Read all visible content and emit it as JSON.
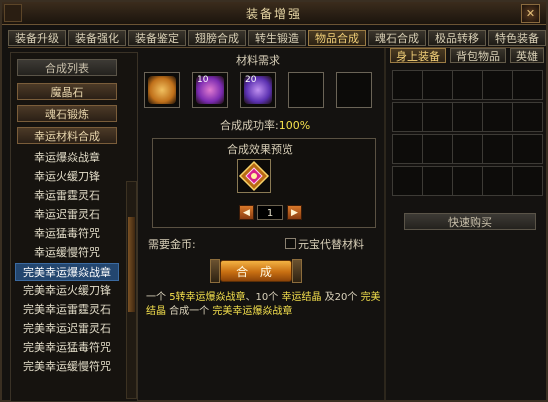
{
  "window": {
    "title": "装备增强",
    "close_icon": "close-icon"
  },
  "tabs": [
    {
      "label": "装备升级",
      "active": false
    },
    {
      "label": "装备强化",
      "active": false
    },
    {
      "label": "装备鉴定",
      "active": false
    },
    {
      "label": "翅膀合成",
      "active": false
    },
    {
      "label": "转生锻造",
      "active": false
    },
    {
      "label": "物品合成",
      "active": true
    },
    {
      "label": "魂石合成",
      "active": false
    },
    {
      "label": "极品转移",
      "active": false
    },
    {
      "label": "特色装备",
      "active": false
    }
  ],
  "sidebar": {
    "header": "合成列表",
    "categories": [
      "魔晶石",
      "魂石锻炼",
      "幸运材料合成"
    ],
    "items": [
      {
        "label": "幸运爆焱战章",
        "selected": false
      },
      {
        "label": "幸运火缓刀锋",
        "selected": false
      },
      {
        "label": "幸运雷霆灵石",
        "selected": false
      },
      {
        "label": "幸运迟雷灵石",
        "selected": false
      },
      {
        "label": "幸运猛毒符咒",
        "selected": false
      },
      {
        "label": "幸运缓慢符咒",
        "selected": false
      },
      {
        "label": "完美幸运爆焱战章",
        "selected": true
      },
      {
        "label": "完美幸运火缓刀锋",
        "selected": false
      },
      {
        "label": "完美幸运雷霆灵石",
        "selected": false
      },
      {
        "label": "完美幸运迟雷灵石",
        "selected": false
      },
      {
        "label": "完美幸运猛毒符咒",
        "selected": false
      },
      {
        "label": "完美幸运缓慢符咒",
        "selected": false
      }
    ]
  },
  "materials": {
    "title": "材料需求",
    "slots": [
      {
        "icon": "war-badge-icon",
        "count": ""
      },
      {
        "icon": "purple-crystal-icon",
        "count": "10"
      },
      {
        "icon": "violet-gem-icon",
        "count": "20"
      },
      {
        "icon": "empty-slot-icon",
        "count": ""
      },
      {
        "icon": "empty-slot-icon",
        "count": ""
      }
    ]
  },
  "success_rate": {
    "label": "合成成功率:",
    "value": "100%"
  },
  "preview": {
    "title": "合成效果预览",
    "quantity": "1",
    "result_icon": "perfect-war-badge-icon"
  },
  "gold": {
    "label": "需要金币:",
    "value": ""
  },
  "substitute": {
    "label": "元宝代替材料",
    "checked": false
  },
  "combine_button": "合 成",
  "description": {
    "parts": [
      {
        "text": "一个 ",
        "highlight": false
      },
      {
        "text": "5转幸运爆焱战章",
        "highlight": true
      },
      {
        "text": "、10个 ",
        "highlight": false
      },
      {
        "text": "幸运结晶",
        "highlight": true
      },
      {
        "text": " 及20个 ",
        "highlight": false
      },
      {
        "text": "完美结晶",
        "highlight": true
      },
      {
        "text": " 合成一个 ",
        "highlight": false
      },
      {
        "text": "完美幸运爆焱战章",
        "highlight": true
      }
    ]
  },
  "right_panel": {
    "tabs": [
      {
        "label": "身上装备",
        "active": true
      },
      {
        "label": "背包物品",
        "active": false
      },
      {
        "label": "英雄",
        "active": false
      }
    ],
    "quick_buy": "快速购买"
  },
  "colors": {
    "accent": "#f2d079",
    "highlight": "#f4e04d",
    "selected_row": "#23466f",
    "button": "#e08a20"
  }
}
